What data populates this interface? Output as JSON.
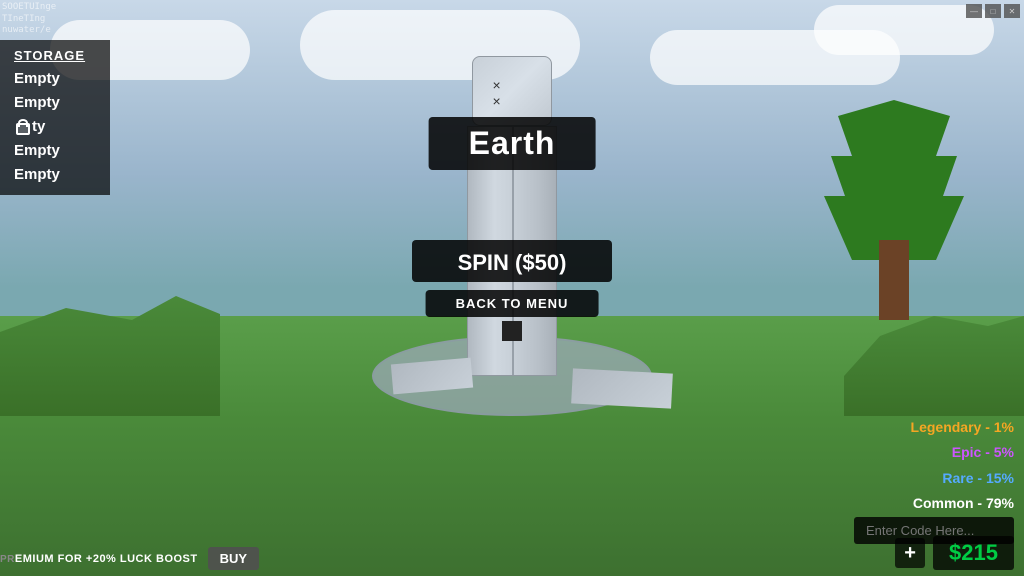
{
  "game": {
    "title": "Earth",
    "character_label": "Earth"
  },
  "buttons": {
    "spin_label": "SPIN ($50)",
    "back_to_menu_label": "BACK TO MENU",
    "buy_label": "BUY",
    "plus_label": "+"
  },
  "storage": {
    "title": "STORAGE",
    "items": [
      {
        "label": "Empty",
        "locked": false
      },
      {
        "label": "Empty",
        "locked": false
      },
      {
        "label": "Empty",
        "locked": true
      },
      {
        "label": "Empty",
        "locked": false
      },
      {
        "label": "Empty",
        "locked": false
      }
    ]
  },
  "rarities": [
    {
      "label": "Legendary - 1%",
      "color": "#f5a623"
    },
    {
      "label": "Epic - 5%",
      "color": "#cc55ff"
    },
    {
      "label": "Rare - 15%",
      "color": "#55aaff"
    },
    {
      "label": "Common - 79%",
      "color": "#ffffff"
    }
  ],
  "code_input": {
    "placeholder": "Enter Code Here..."
  },
  "money": {
    "amount": "$215",
    "color": "#00cc44"
  },
  "premium": {
    "text": "EMIUM FOR +20% LUCK BOOST"
  },
  "stream_text": {
    "line1": "SOOETUInge",
    "line2": "TIneTIng",
    "line3": "nuwater/e"
  }
}
